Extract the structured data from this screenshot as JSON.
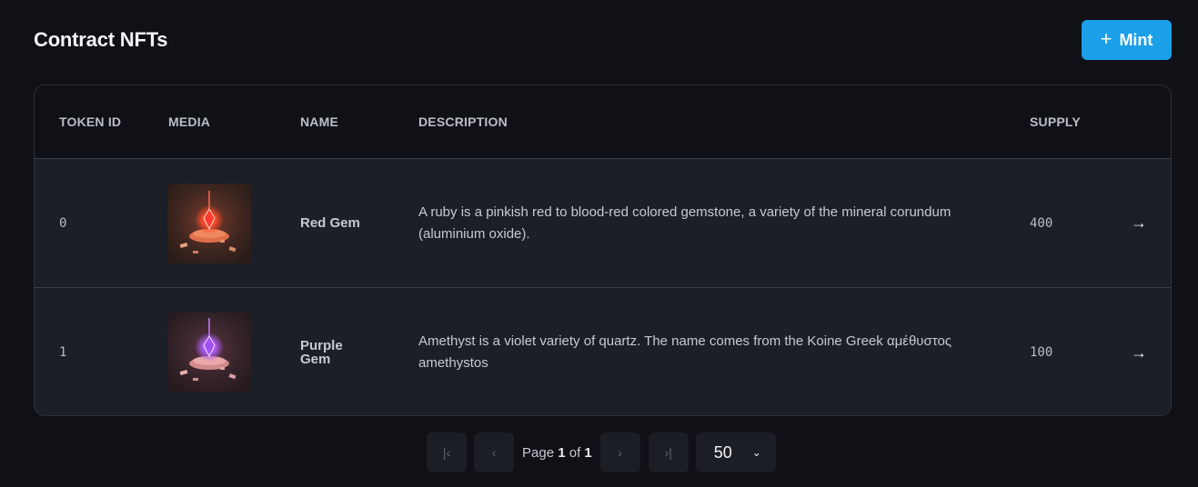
{
  "header": {
    "title": "Contract NFTs",
    "mint_label": "Mint",
    "mint_icon": "plus-icon"
  },
  "table": {
    "columns": [
      "TOKEN ID",
      "MEDIA",
      "NAME",
      "DESCRIPTION",
      "SUPPLY"
    ],
    "rows": [
      {
        "token_id": "0",
        "media": "red gem",
        "name": "Red Gem",
        "description": "A ruby is a pinkish red to blood-red colored gemstone, a variety of the mineral corundum (aluminium oxide).",
        "supply": "400",
        "gem_color": "#ff3b2f"
      },
      {
        "token_id": "1",
        "media": "purple gem",
        "name": "Purple Gem",
        "description": "Amethyst is a violet variety of quartz. The name comes from the Koine Greek αμέθυστος amethystos",
        "supply": "100",
        "gem_color": "#b05cff"
      }
    ],
    "row_action_icon": "arrow-right-icon"
  },
  "pagination": {
    "page_word": "Page",
    "current_page": "1",
    "of_word": "of",
    "total_pages": "1",
    "page_size": "50"
  },
  "colors": {
    "background": "#0f1116",
    "row_background": "#1b1f27",
    "accent": "#1a9fe8"
  }
}
